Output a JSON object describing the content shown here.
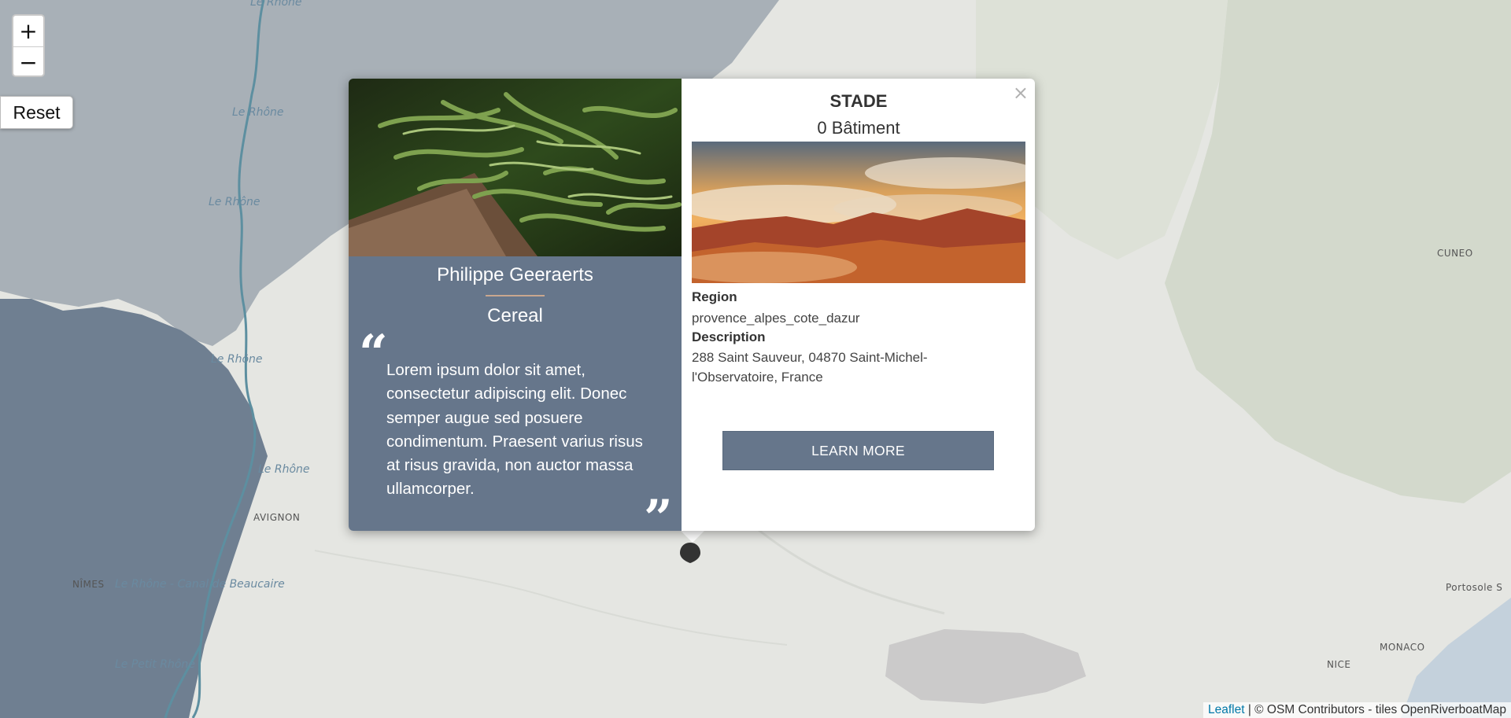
{
  "map": {
    "labels": {
      "rhone_1": "Le Rhône",
      "rhone_2": "Le Rhône",
      "rhone_3": "Le Rhône",
      "rhone_4": "Le Rhône",
      "rhone_5": "Le Rhône",
      "rhone_6": "Le Rhône",
      "avignon": "AVIGNON",
      "nimes": "NÎMES",
      "canal": "Le Rhône - Canal de Beaucaire",
      "rhone_bottom": "Le Petit Rhône",
      "cuneo": "CUNEO",
      "portosole": "Portosole S",
      "monaco": "MONACO",
      "nice": "NICE"
    },
    "colors": {
      "sea": "#6f7f91",
      "land": "#e4e6e2",
      "river": "#5d8fa0",
      "mountains": "#cfd4cc"
    }
  },
  "controls": {
    "zoom_in": "+",
    "zoom_out": "−",
    "reset": "Reset"
  },
  "popup": {
    "close": "×",
    "left": {
      "image": "green-beans-photo",
      "name": "Philippe Geeraerts",
      "role": "Cereal",
      "quote_open": "“",
      "quote": "Lorem ipsum dolor sit amet, consectetur adipiscing elit. Donec semper augue sed posuere condimentum. Praesent varius risus at risus gravida, non auctor massa ullamcorper.",
      "quote_close": "”"
    },
    "right": {
      "title": "STADE",
      "subtitle": "0 Bâtiment",
      "image": "sunset-mountains-photo",
      "region_label": "Region",
      "region_value": "provence_alpes_cote_dazur",
      "description_label": "Description",
      "description_value": "288 Saint Sauveur, 04870 Saint-Michel-l'Observatoire, France",
      "button": "LEARN MORE"
    },
    "accent_color": "#66768b"
  },
  "attribution": {
    "leaflet": "Leaflet",
    "rest": " | © OSM Contributors - tiles OpenRiverboatMap"
  }
}
